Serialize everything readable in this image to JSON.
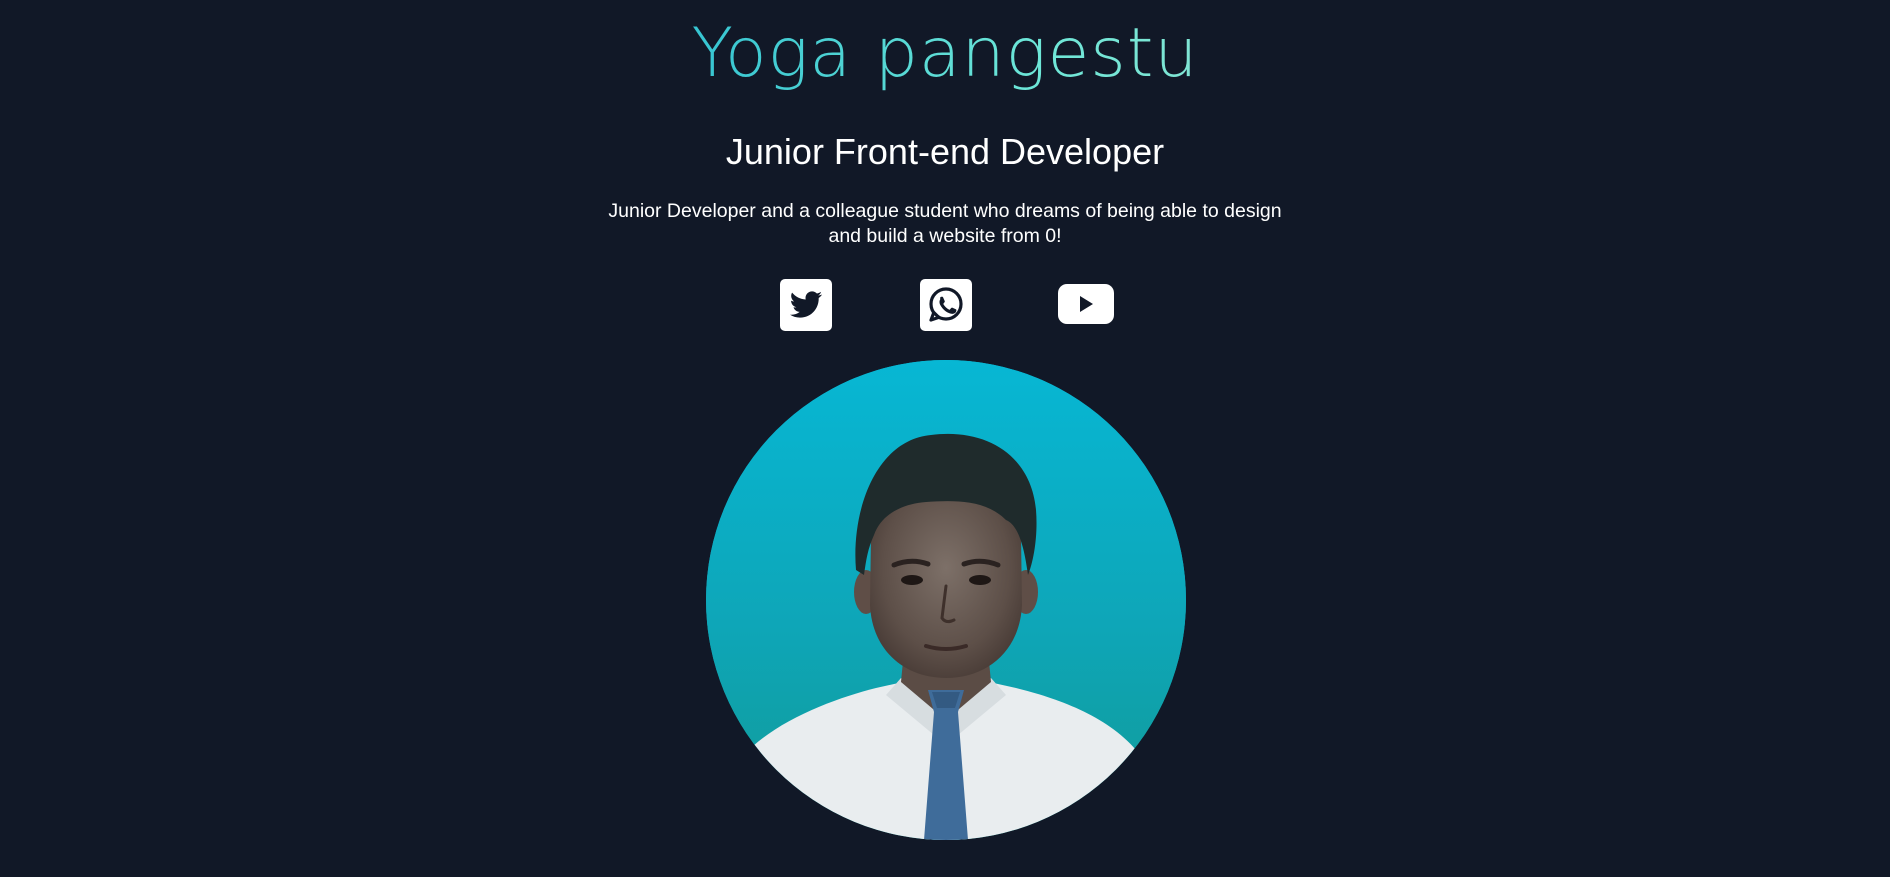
{
  "profile": {
    "name": "Yoga pangestu",
    "role": "Junior Front-end Developer",
    "bio": "Junior Developer and a colleague student who dreams of being able to design and build a website from 0!"
  },
  "socials": [
    {
      "network": "Twitter",
      "icon": "twitter-icon"
    },
    {
      "network": "WhatsApp",
      "icon": "whatsapp-icon"
    },
    {
      "network": "YouTube",
      "icon": "youtube-icon"
    }
  ],
  "colors": {
    "background": "#111827",
    "name_gradient_start": "#22b8cf",
    "name_gradient_end": "#8ee3d0",
    "text": "#ffffff",
    "photo_background": "#0ea5b7"
  }
}
